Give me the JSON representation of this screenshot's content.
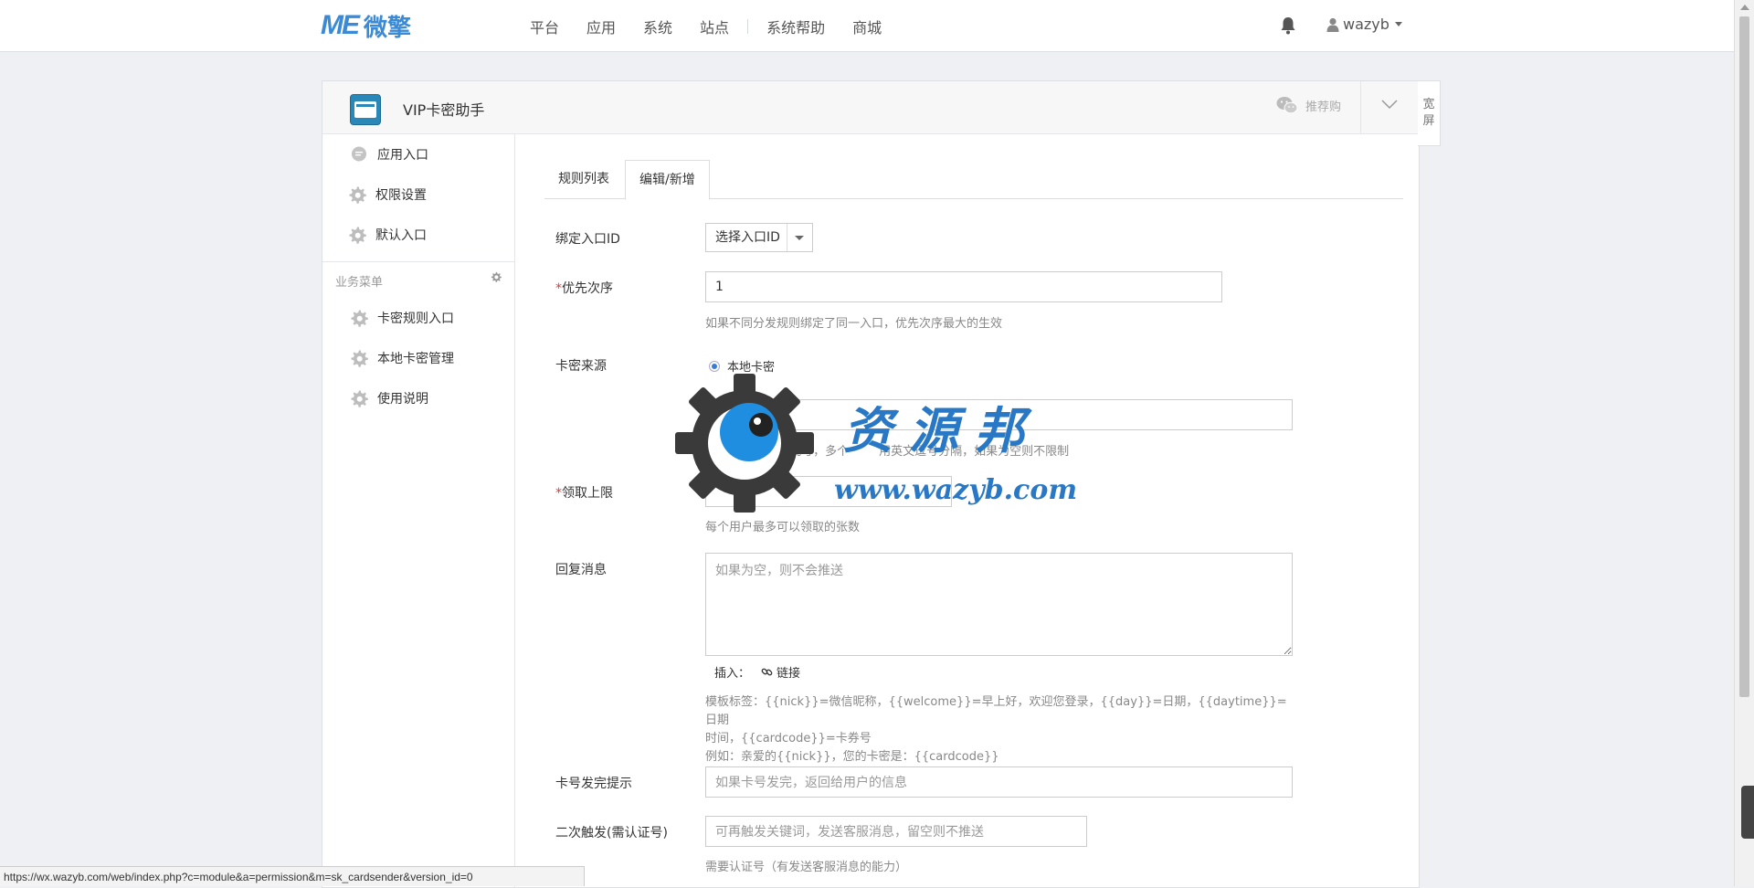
{
  "topbar": {
    "logo_mark": "ME",
    "logo_text": "微擎",
    "nav": [
      "平台",
      "应用",
      "系统",
      "站点",
      "系统帮助",
      "商城"
    ],
    "username": "wazyb"
  },
  "app": {
    "title": "VIP卡密助手",
    "recommend": "推荐购",
    "wide_screen": [
      "宽",
      "屏"
    ]
  },
  "sidebar": {
    "top_items": [
      {
        "label": "应用入口",
        "icon": "chat-bubble-icon"
      },
      {
        "label": "权限设置",
        "icon": "gear-icon"
      },
      {
        "label": "默认入口",
        "icon": "gear-icon"
      }
    ],
    "group_title": "业务菜单",
    "business_items": [
      {
        "label": "卡密规则入口",
        "icon": "gear-icon"
      },
      {
        "label": "本地卡密管理",
        "icon": "gear-icon"
      },
      {
        "label": "使用说明",
        "icon": "gear-icon"
      }
    ]
  },
  "tabs": [
    {
      "label": "规则列表",
      "active": false
    },
    {
      "label": "编辑/新增",
      "active": true
    }
  ],
  "form": {
    "bind_entry": {
      "label": "绑定入口ID",
      "selected": "选择入口ID"
    },
    "priority": {
      "required_mark": "*",
      "label": "优先次序",
      "value": "1",
      "help": "如果不同分发规则绑定了同一入口，优先次序最大的生效"
    },
    "card_source": {
      "label": "卡密来源",
      "radio_option": "本地卡密",
      "input_placeholder": "限",
      "help": "本地                批号，多个        用英文逗号分隔，如果为空则不限制"
    },
    "limit": {
      "required_mark": "*",
      "label": "领取上限",
      "help": "每个用户最多可以领取的张数"
    },
    "reply": {
      "label": "回复消息",
      "placeholder": "如果为空，则不会推送",
      "insert_label": "插入：",
      "insert_link": "链接",
      "template_line1": "模板标签：{{nick}}=微信昵称，{{welcome}}=早上好，欢迎您登录，{{day}}=日期，{{daytime}}=日期",
      "template_line2": "时间，{{cardcode}}=卡券号",
      "template_line3": "例如：亲爱的{{nick}}，您的卡密是：{{cardcode}}"
    },
    "exhausted": {
      "label": "卡号发完提示",
      "placeholder": "如果卡号发完，返回给用户的信息"
    },
    "second_trigger": {
      "label": "二次触发(需认证号)",
      "placeholder": "可再触发关键词，发送客服消息，留空则不推送",
      "help": "需要认证号（有发送客服消息的能力）"
    }
  },
  "watermark": {
    "cn": "资源邦",
    "url": "www.wazyb.com"
  },
  "statusbar": {
    "url": "https://wx.wazyb.com/web/index.php?c=module&a=permission&m=sk_cardsender&version_id=0"
  },
  "colors": {
    "brand": "#3b8ad6",
    "required": "#e33333",
    "radio_active": "#3a7bd5"
  }
}
